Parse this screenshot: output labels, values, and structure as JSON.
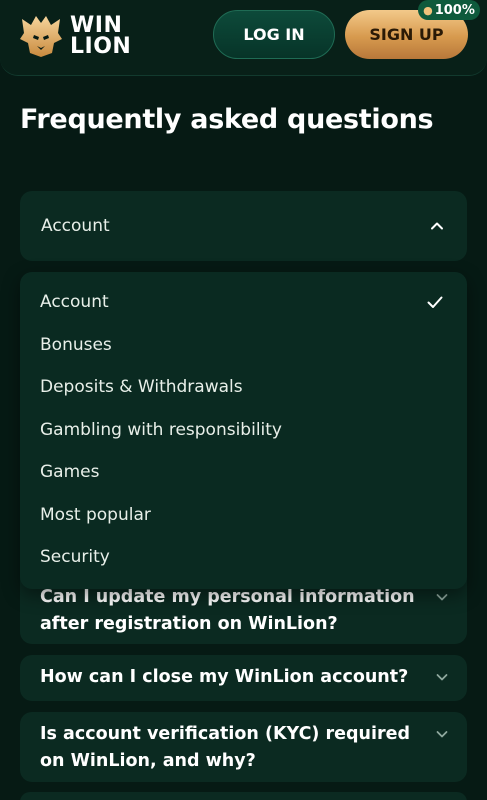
{
  "header": {
    "logo_line1": "WIN",
    "logo_line2": "LION",
    "login_label": "LOG IN",
    "signup_label": "SIGN UP",
    "bonus_badge": "100%"
  },
  "page_title": "Frequently asked questions",
  "category_select": {
    "selected": "Account",
    "options": [
      "Account",
      "Bonuses",
      "Deposits & Withdrawals",
      "Gambling with responsibility",
      "Games",
      "Most popular",
      "Security"
    ]
  },
  "faq": [
    {
      "question": "Can I update my personal information after registration on WinLion?"
    },
    {
      "question": "How can I close my WinLion account?"
    },
    {
      "question": "Is account verification (KYC) required on WinLion, and why?"
    }
  ],
  "colors": {
    "background": "#061a14",
    "card": "#0b2a21",
    "accent_gold": "#d79a4e",
    "login_green": "#0d4a3a"
  }
}
